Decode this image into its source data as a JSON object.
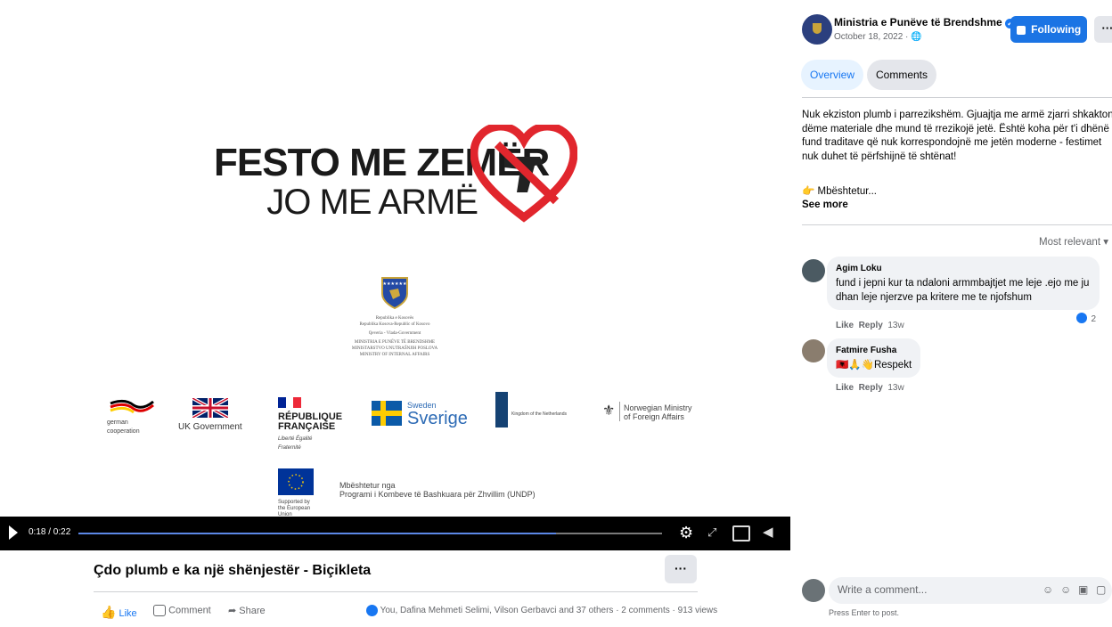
{
  "video": {
    "headline_line1": "FESTO ME ZEMËR",
    "headline_line2": "JO ME ARMË",
    "emblem_text1": "Republika e Kosovës",
    "emblem_text2": "Republika Kosova-Republic of Kosovo",
    "emblem_text3": "Qeveria - Vlada-Government",
    "emblem_text4": "MINISTRIA E PUNËVE TË BRENDSHME",
    "emblem_text5": "MINISTARSTVO UNUTRAŠNJIH POSLOVA",
    "emblem_text6": "MINISTRY OF INTERNAL AFFAIRS",
    "sponsors": {
      "german": "german cooperation",
      "uk": "UK Government",
      "france_line1": "RÉPUBLIQUE",
      "france_line2": "FRANÇAISE",
      "france_motto": "Liberté Égalité Fraternité",
      "sweden_small": "Sweden",
      "sweden_big": "Sverige",
      "netherlands": "Kingdom of the Netherlands",
      "norway_line1": "Norwegian Ministry",
      "norway_line2": "of Foreign Affairs",
      "eu": "Supported by the European Union",
      "undp_line1": "Mbështetur nga",
      "undp_line2": "Programi i Kombeve të Bashkuara për Zhvillim (UNDP)"
    },
    "time": "0:18 / 0:22",
    "progress_fraction": 0.8182
  },
  "post": {
    "title": "Çdo plumb e ka një shënjestër - Biçikleta",
    "more_label": "···",
    "like_label": "Like",
    "comment_label": "Comment",
    "share_label": "Share",
    "reactions_summary": "You, Dafina Mehmeti Selimi, Vilson Gerbavci and 37 others · 2 comments · 913 views"
  },
  "sidebar": {
    "page_name": "Ministria e Punëve të Brendshme",
    "date": "October 18, 2022 · ",
    "follow_label": "Following",
    "more_label": "···",
    "tabs": [
      {
        "label": "Overview"
      },
      {
        "label": "Comments"
      }
    ],
    "post_text": "Nuk ekziston plumb i parrezikshëm. Gjuajtja me armë zjarri shkakton dëme materiale dhe mund të rrezikojë jetë. Është koha për t'i dhënë fund traditave që nuk korrespondojnë me jetën moderne - festimet nuk duhet të përfshijnë të shtënat!",
    "supported_text": "👉 Mbështetur...",
    "see_more": "See more",
    "sort_label": "Most relevant ▾",
    "comments": [
      {
        "author": "Agim Loku",
        "text": "fund i jepni kur ta ndaloni armmbajtjet me leje .ejo me ju dhan leje njerzve pa kritere me te njofshum",
        "like": "Like",
        "reply": "Reply",
        "age": "13w",
        "reaction_count": "2"
      },
      {
        "author": "Fatmire Fusha",
        "text": "🇦🇱🙏👋Respekt",
        "like": "Like",
        "reply": "Reply",
        "age": "13w"
      }
    ],
    "write_placeholder": "Write a comment...",
    "press_enter": "Press Enter to post."
  },
  "colors": {
    "accent": "#1877f2",
    "heart_red": "#e1262d",
    "progress": "#5b87e6"
  }
}
